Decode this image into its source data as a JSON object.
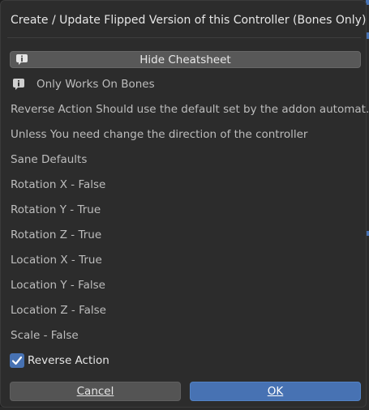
{
  "dialog": {
    "title": "Create / Update Flipped Version of this Controller (Bones Only)",
    "cheatsheet_button": "Hide Cheatsheet",
    "info_note": "Only Works On Bones",
    "lines": [
      "Reverse Action Should use the default set by the addon automat...",
      "Unless You need change the direction of the controller",
      "Sane Defaults",
      "Rotation X - False",
      "Rotation Y - True",
      "Rotation Z - True",
      "Location X - True",
      "Location Y - False",
      "Location Z - False",
      "Scale - False"
    ],
    "reverse_action": {
      "label": "Reverse Action",
      "checked": true
    },
    "cancel_label": "Cancel",
    "ok_label": "OK"
  },
  "icons": {
    "info": "info-icon",
    "check": "checkmark-icon"
  },
  "colors": {
    "accent": "#4772b3",
    "panel": "#2c2c2c",
    "button": "#585858"
  }
}
